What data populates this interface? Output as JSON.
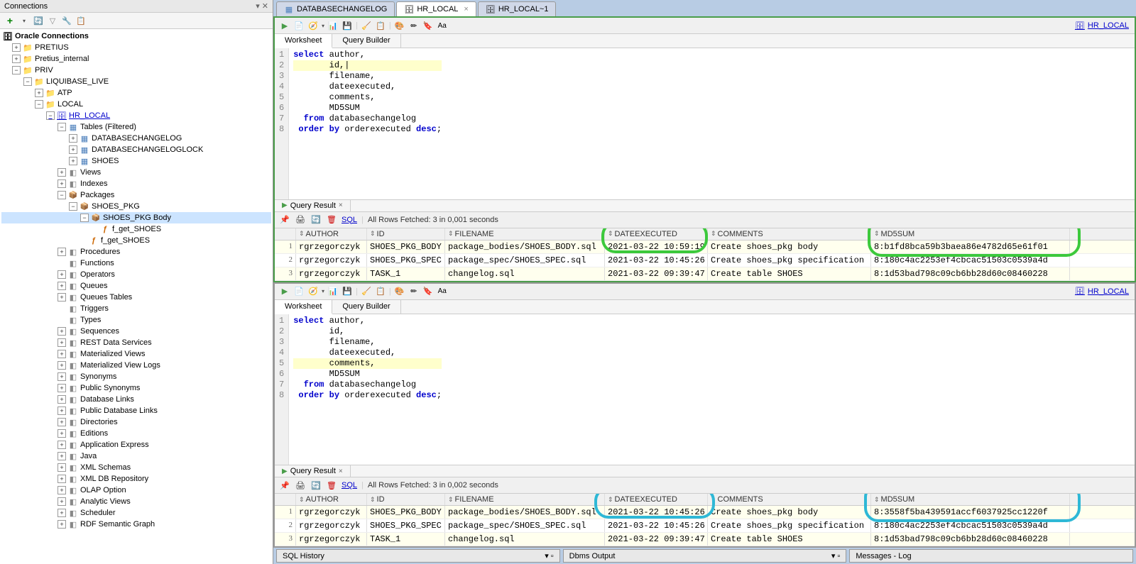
{
  "left": {
    "title": "Connections",
    "section": "Oracle Connections",
    "nodes": {
      "pretius": "PRETIUS",
      "pretius_internal": "Pretius_internal",
      "priv": "PRIV",
      "liquibase_live": "LIQUIBASE_LIVE",
      "atp": "ATP",
      "local": "LOCAL",
      "hr_local": "HR_LOCAL",
      "tables": "Tables (Filtered)",
      "dbchangelog": "DATABASECHANGELOG",
      "dbchangeloglock": "DATABASECHANGELOGLOCK",
      "shoes": "SHOES",
      "views": "Views",
      "indexes": "Indexes",
      "packages": "Packages",
      "shoes_pkg": "SHOES_PKG",
      "shoes_pkg_body": "SHOES_PKG Body",
      "f_get_shoes1": "f_get_SHOES",
      "f_get_shoes2": "f_get_SHOES",
      "procedures": "Procedures",
      "functions": "Functions",
      "operators": "Operators",
      "queues": "Queues",
      "queues_tables": "Queues Tables",
      "triggers": "Triggers",
      "types": "Types",
      "sequences": "Sequences",
      "rest": "REST Data Services",
      "mat_views": "Materialized Views",
      "mat_view_logs": "Materialized View Logs",
      "synonyms": "Synonyms",
      "pub_synonyms": "Public Synonyms",
      "db_links": "Database Links",
      "pub_db_links": "Public Database Links",
      "directories": "Directories",
      "editions": "Editions",
      "app_express": "Application Express",
      "java": "Java",
      "xml_schemas": "XML Schemas",
      "xml_db_repo": "XML DB Repository",
      "olap": "OLAP Option",
      "analytic": "Analytic Views",
      "scheduler": "Scheduler",
      "rdf": "RDF Semantic Graph"
    }
  },
  "tabs": {
    "t1": "DATABASECHANGELOG",
    "t2": "HR_LOCAL",
    "t3": "HR_LOCAL~1"
  },
  "pane": {
    "db_label": "HR_LOCAL",
    "worksheet": "Worksheet",
    "query_builder": "Query Builder",
    "query_result": "Query Result",
    "sql_link": "SQL",
    "status1": "All Rows Fetched: 3 in 0,001 seconds",
    "status2": "All Rows Fetched: 3 in 0,002 seconds"
  },
  "code": {
    "l1": "select author,",
    "l2": "       id,",
    "l3": "       filename,",
    "l4": "       dateexecuted,",
    "l5": "       comments,",
    "l6": "       MD5SUM",
    "l7": "  from databasechangelog",
    "l8": " order by orderexecuted desc;"
  },
  "cols": {
    "author": "AUTHOR",
    "id": "ID",
    "filename": "FILENAME",
    "dateexecuted": "DATEEXECUTED",
    "comments": "COMMENTS",
    "md5sum": "MD5SUM"
  },
  "grid1": [
    {
      "n": "1",
      "author": "rgrzegorczyk",
      "id": "SHOES_PKG_BODY",
      "filename": "package_bodies/SHOES_BODY.sql",
      "date": "2021-03-22 10:59:19",
      "comments": "Create shoes_pkg body",
      "md5": "8:b1fd8bca59b3baea86e4782d65e61f01"
    },
    {
      "n": "2",
      "author": "rgrzegorczyk",
      "id": "SHOES_PKG_SPEC",
      "filename": "package_spec/SHOES_SPEC.sql",
      "date": "2021-03-22 10:45:26",
      "comments": "Create shoes_pkg specification",
      "md5": "8:180c4ac2253ef4cbcac51503c0539a4d"
    },
    {
      "n": "3",
      "author": "rgrzegorczyk",
      "id": "TASK_1",
      "filename": "changelog.sql",
      "date": "2021-03-22 09:39:47",
      "comments": "Create table SHOES",
      "md5": "8:1d53bad798c09cb6bb28d60c08460228"
    }
  ],
  "grid2": [
    {
      "n": "1",
      "author": "rgrzegorczyk",
      "id": "SHOES_PKG_BODY",
      "filename": "package_bodies/SHOES_BODY.sql",
      "date": "2021-03-22 10:45:26",
      "comments": "Create shoes_pkg body",
      "md5": "8:3558f5ba439591accf6037925cc1220f"
    },
    {
      "n": "2",
      "author": "rgrzegorczyk",
      "id": "SHOES_PKG_SPEC",
      "filename": "package_spec/SHOES_SPEC.sql",
      "date": "2021-03-22 10:45:26",
      "comments": "Create shoes_pkg specification",
      "md5": "8:180c4ac2253ef4cbcac51503c0539a4d"
    },
    {
      "n": "3",
      "author": "rgrzegorczyk",
      "id": "TASK_1",
      "filename": "changelog.sql",
      "date": "2021-03-22 09:39:47",
      "comments": "Create table SHOES",
      "md5": "8:1d53bad798c09cb6bb28d60c08460228"
    }
  ],
  "bottom": {
    "sql_history": "SQL History",
    "dbms_output": "Dbms Output",
    "messages_log": "Messages - Log"
  }
}
